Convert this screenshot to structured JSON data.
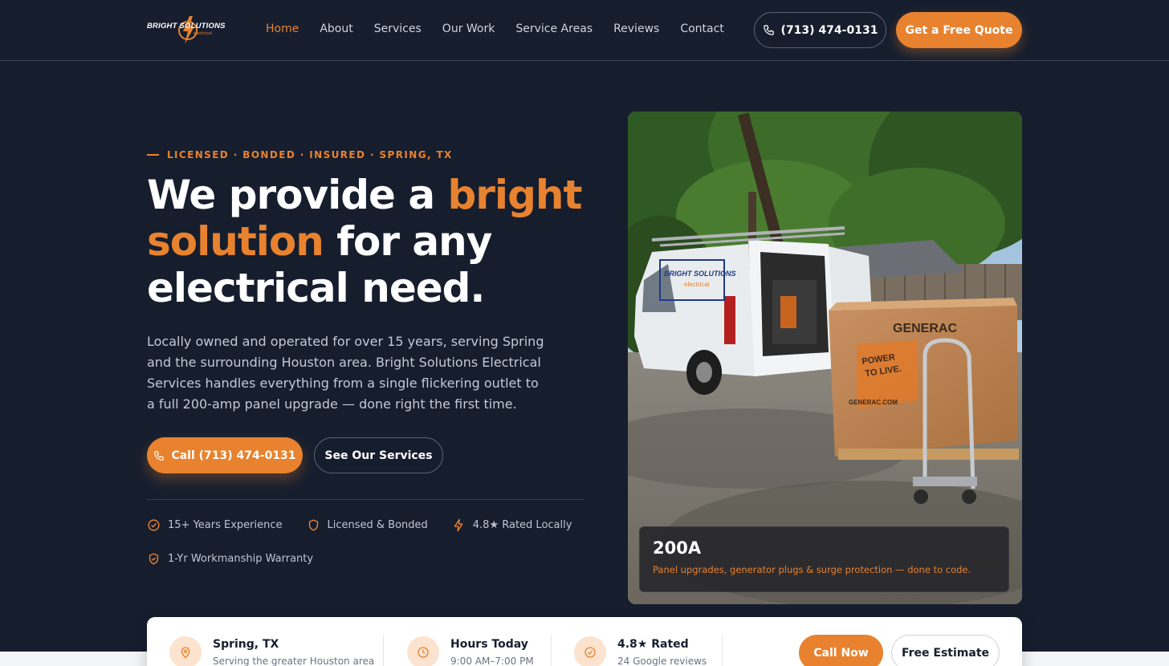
{
  "brand": {
    "logo_text": "BRIGHT SOLUTIONS",
    "logo_sub": "electrical",
    "accent": "#e8822f",
    "background": "#161e2e"
  },
  "nav": {
    "links": [
      "Home",
      "About",
      "Services",
      "Our Work",
      "Service Areas",
      "Reviews",
      "Contact"
    ],
    "phone": "(713) 474-0131",
    "quote_label": "Get a Free Quote"
  },
  "hero": {
    "eyebrow": "LICENSED · BONDED · INSURED · SPRING, TX",
    "headline_part1": "We provide a ",
    "headline_highlight": "bright solution",
    "headline_part2": " for any electrical need.",
    "lead": "Locally owned and operated for over 15 years, serving Spring and the surrounding Houston area. Bright Solutions Electrical Services handles everything from a single flickering outlet to a full 200-amp panel upgrade — done right the first time.",
    "call_label": "Call (713) 474-0131",
    "services_label": "See Our Services",
    "badges": [
      {
        "icon": "check-circle-icon",
        "label": "15+ Years Experience"
      },
      {
        "icon": "shield-icon",
        "label": "Licensed & Bonded"
      },
      {
        "icon": "bolt-icon",
        "label": "4.8★ Rated Locally"
      },
      {
        "icon": "shield-check-icon",
        "label": "1-Yr Workmanship Warranty"
      }
    ]
  },
  "photo": {
    "overlay_title": "200A",
    "overlay_text": "Panel upgrades, generator plugs & surge protection — done to code.",
    "box_brand": "GENERAC",
    "box_slogan": "POWER TO LIVE.",
    "box_url": "GENERAC.COM"
  },
  "infobar": {
    "items": [
      {
        "icon": "map-pin-icon",
        "title": "Spring, TX",
        "sub": "Serving the greater Houston area"
      },
      {
        "icon": "clock-icon",
        "title": "Hours Today",
        "sub": "9:00 AM–7:00 PM"
      },
      {
        "icon": "check-circle-icon",
        "title": "4.8★ Rated",
        "sub": "24 Google reviews"
      }
    ],
    "call_now": "Call Now",
    "free_estimate": "Free Estimate"
  }
}
